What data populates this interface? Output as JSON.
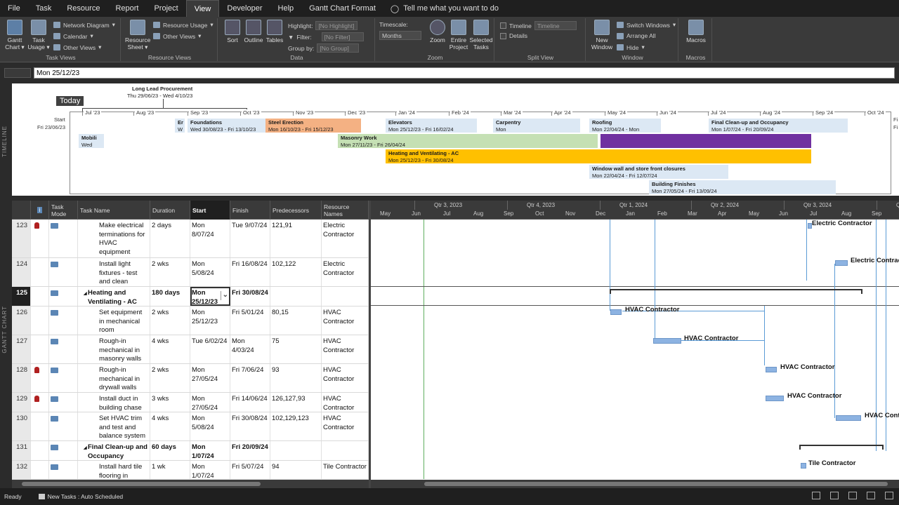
{
  "menu": {
    "tabs": [
      "File",
      "Task",
      "Resource",
      "Report",
      "Project",
      "View",
      "Developer",
      "Help",
      "Gantt Chart Format"
    ],
    "active": "View",
    "tellme": "Tell me what you want to do"
  },
  "ribbon": {
    "task_views": {
      "gantt": "Gantt Chart",
      "gantt_line1": "Gantt",
      "gantt_line2": "Chart ▾",
      "usage_line1": "Task",
      "usage_line2": "Usage ▾",
      "network": "Network Diagram",
      "calendar": "Calendar",
      "other": "Other Views",
      "label": "Task Views"
    },
    "resource_views": {
      "sheet_line1": "Resource",
      "sheet_line2": "Sheet ▾",
      "usage": "Resource Usage",
      "other": "Other Views",
      "label": "Resource Views"
    },
    "data": {
      "sort": "Sort",
      "outline": "Outline",
      "tables": "Tables",
      "highlight_label": "Highlight:",
      "highlight_value": "[No Highlight]",
      "filter_label": "Filter:",
      "filter_value": "[No Filter]",
      "group_label": "Group by:",
      "group_value": "[No Group]",
      "label": "Data"
    },
    "zoom": {
      "timescale_label": "Timescale:",
      "timescale_value": "Months",
      "zoom": "Zoom",
      "entire_line1": "Entire",
      "entire_line2": "Project",
      "selected_line1": "Selected",
      "selected_line2": "Tasks",
      "label": "Zoom"
    },
    "split": {
      "timeline_label": "Timeline",
      "timeline_value": "Timeline",
      "details_label": "Details",
      "label": "Split View"
    },
    "window": {
      "new_line1": "New",
      "new_line2": "Window",
      "switch": "Switch Windows",
      "arrange": "Arrange All",
      "hide": "Hide",
      "label": "Window"
    },
    "macros": {
      "macros": "Macros",
      "label": "Macros"
    }
  },
  "entry": {
    "value": "Mon 25/12/23"
  },
  "timeline": {
    "side_label": "TIMELINE",
    "today": "Today",
    "start_label": "Start",
    "start_date": "Fri 23/06/23",
    "finish_label": "Fi",
    "finish_date": "Fi",
    "months": [
      "Jul '23",
      "Aug '23",
      "Sep '23",
      "Oct '23",
      "Nov '23",
      "Dec '23",
      "Jan '24",
      "Feb '24",
      "Mar '24",
      "Apr '24",
      "May '24",
      "Jun '24",
      "Jul '24",
      "Aug '24",
      "Sep '24",
      "Oct '24"
    ],
    "callout": {
      "title": "Long Lead Procurement",
      "dates": "Thu 29/06/23 - Wed 4/10/23"
    },
    "bars": [
      {
        "name": "Mobili",
        "dates": "Wed",
        "color": "#dce8f4"
      },
      {
        "name": "Er",
        "dates": "W",
        "color": "#dce8f4"
      },
      {
        "name": "Foundations",
        "dates": "Wed 30/08/23 - Fri 13/10/23",
        "color": "#dce8f4"
      },
      {
        "name": "Steel Erection",
        "dates": "Mon 16/10/23 - Fri 15/12/23",
        "color": "#f4b183"
      },
      {
        "name": "Elevators",
        "dates": "Mon 25/12/23 - Fri 16/02/24",
        "color": "#dce8f4"
      },
      {
        "name": "Carpentry",
        "dates": "Mon",
        "color": "#dce8f4"
      },
      {
        "name": "Roofing",
        "dates": "Mon 22/04/24 - Mon",
        "color": "#dce8f4"
      },
      {
        "name": "Final Clean-up and Occupancy",
        "dates": "Mon 1/07/24 - Fri 20/09/24",
        "color": "#dce8f4"
      },
      {
        "name": "Masonry Work",
        "dates": "Mon 27/11/23 - Fri 26/04/24",
        "color": "#c5e0b4"
      },
      {
        "name": "",
        "dates": "",
        "color": "#7030a0"
      },
      {
        "name": "Heating and Ventilating - AC",
        "dates": "Mon 25/12/23 - Fri 30/08/24",
        "color": "#ffc000"
      },
      {
        "name": "Window wall and store front closures",
        "dates": "Mon 22/04/24 - Fri 12/07/24",
        "color": "#dce8f4"
      },
      {
        "name": "Building Finishes",
        "dates": "Mon 27/05/24 - Fri 13/09/24",
        "color": "#dce8f4"
      }
    ]
  },
  "gantt": {
    "side_label": "GANTT CHART",
    "columns": {
      "info": "i",
      "mode": "Task Mode",
      "name": "Task Name",
      "duration": "Duration",
      "start": "Start",
      "finish": "Finish",
      "pred": "Predecessors",
      "res": "Resource Names"
    },
    "rows": [
      {
        "id": "123",
        "person": true,
        "name": "Make electrical terminations for HVAC equipment",
        "duration": "2 days",
        "start": "Mon 8/07/24",
        "finish": "Tue 9/07/24",
        "pred": "121,91",
        "res": "Electric Contractor"
      },
      {
        "id": "124",
        "person": false,
        "name": "Install light fixtures - test and clean",
        "duration": "2 wks",
        "start": "Mon 5/08/24",
        "finish": "Fri 16/08/24",
        "pred": "102,122",
        "res": "Electric Contractor"
      },
      {
        "id": "125",
        "person": false,
        "summary": true,
        "name": "Heating and Ventilating - AC",
        "duration": "180 days",
        "start": "Mon 25/12/23",
        "finish": "Fri 30/08/24",
        "pred": "",
        "res": ""
      },
      {
        "id": "126",
        "person": false,
        "name": "Set equipment in mechanical room",
        "duration": "2 wks",
        "start": "Mon 25/12/23",
        "finish": "Fri 5/01/24",
        "pred": "80,15",
        "res": "HVAC Contractor"
      },
      {
        "id": "127",
        "person": false,
        "name": "Rough-in mechanical in masonry walls",
        "duration": "4 wks",
        "start": "Tue 6/02/24",
        "finish": "Mon 4/03/24",
        "pred": "75",
        "res": "HVAC Contractor"
      },
      {
        "id": "128",
        "person": true,
        "name": "Rough-in mechanical in drywall walls",
        "duration": "2 wks",
        "start": "Mon 27/05/24",
        "finish": "Fri 7/06/24",
        "pred": "93",
        "res": "HVAC Contractor"
      },
      {
        "id": "129",
        "person": true,
        "name": "Install duct in building chase",
        "duration": "3 wks",
        "start": "Mon 27/05/24",
        "finish": "Fri 14/06/24",
        "pred": "126,127,93",
        "res": "HVAC Contractor"
      },
      {
        "id": "130",
        "person": false,
        "name": "Set HVAC trim and test and balance system",
        "duration": "4 wks",
        "start": "Mon 5/08/24",
        "finish": "Fri 30/08/24",
        "pred": "102,129,123",
        "res": "HVAC Contractor"
      },
      {
        "id": "131",
        "person": false,
        "summary": true,
        "name": "Final Clean-up and Occupancy",
        "duration": "60 days",
        "start": "Mon 1/07/24",
        "finish": "Fri 20/09/24",
        "pred": "",
        "res": ""
      },
      {
        "id": "132",
        "person": false,
        "name": "Install hard tile flooring in",
        "duration": "1 wk",
        "start": "Mon 1/07/24",
        "finish": "Fri 5/07/24",
        "pred": "94",
        "res": "Tile Contractor"
      }
    ],
    "chart": {
      "quarters": [
        "Qtr 3, 2023",
        "Qtr 4, 2023",
        "Qtr 1, 2024",
        "Qtr 2, 2024",
        "Qtr 3, 2024",
        "Q"
      ],
      "months": [
        "May",
        "Jun",
        "Jul",
        "Aug",
        "Sep",
        "Oct",
        "Nov",
        "Dec",
        "Jan",
        "Feb",
        "Mar",
        "Apr",
        "May",
        "Jun",
        "Jul",
        "Aug",
        "Sep"
      ],
      "bar_labels": [
        "Electric Contractor",
        "Electric Contrac",
        "HVAC Contractor",
        "HVAC Contractor",
        "HVAC Contractor",
        "HVAC Contractor",
        "HVAC Cont",
        "Tile Contractor"
      ]
    }
  },
  "status": {
    "ready": "Ready",
    "new_tasks": "New Tasks : Auto Scheduled"
  }
}
